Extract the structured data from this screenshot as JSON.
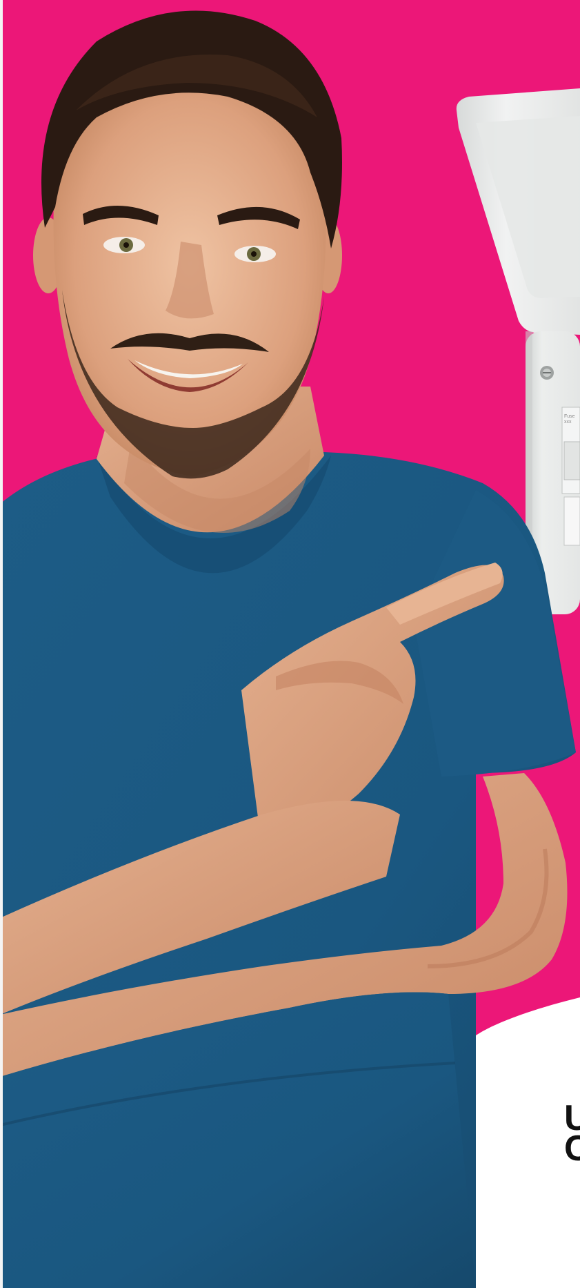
{
  "scene": {
    "description_colors": {
      "background": "#ec1778",
      "tshirt": "#1f5f88",
      "skin": "#d9a07f",
      "hair": "#2a1a12",
      "panel": "#e9ebea"
    }
  },
  "partial_text": {
    "line1": "U",
    "line2": "C"
  },
  "panel_label": {
    "line1": "Fuse",
    "line2": "xxx"
  }
}
